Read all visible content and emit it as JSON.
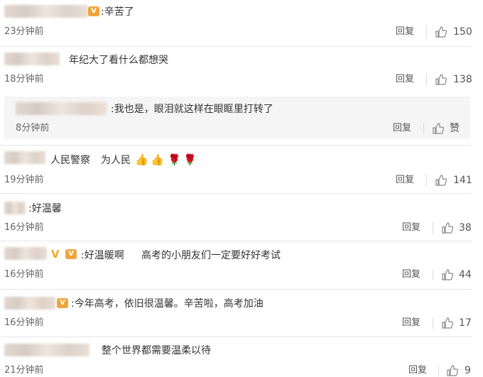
{
  "comments": [
    {
      "text": ":辛苦了",
      "time": "23分钟前",
      "reply": "回复",
      "likes": "150"
    },
    {
      "text": "年纪大了看什么都想哭",
      "time": "18分钟前",
      "reply": "回复",
      "likes": "138",
      "sub": {
        "text": ":我也是，眼泪就这样在眼眶里打转了",
        "time": "8分钟前",
        "reply": "回复",
        "likes": "赞"
      }
    },
    {
      "text": "人民警察",
      "text2": "为人民",
      "time": "19分钟前",
      "reply": "回复",
      "likes": "141"
    },
    {
      "text": ":好温馨",
      "time": "16分钟前",
      "reply": "回复",
      "likes": "38"
    },
    {
      "text": ":好温暖啊",
      "text2": "高考的小朋友们一定要好好考试",
      "time": "16分钟前",
      "reply": "回复",
      "likes": "44"
    },
    {
      "text": ":今年高考，依旧很温馨。辛苦啦，高考加油",
      "time": "16分钟前",
      "reply": "回复",
      "likes": "17"
    },
    {
      "text": "整个世界都需要温柔以待",
      "time": "21分钟前",
      "reply": "回复",
      "likes": "9"
    }
  ],
  "icons": {
    "like": "thumbs-up-icon",
    "vip": "vip-badge-icon",
    "verified": "verified-v-icon",
    "rose": "rose-icon",
    "thumb_emoji": "thumbs-up-emoji"
  },
  "colors": {
    "accent": "#f5a623",
    "muted": "#666666",
    "nested_bg": "#f5f5f5"
  }
}
